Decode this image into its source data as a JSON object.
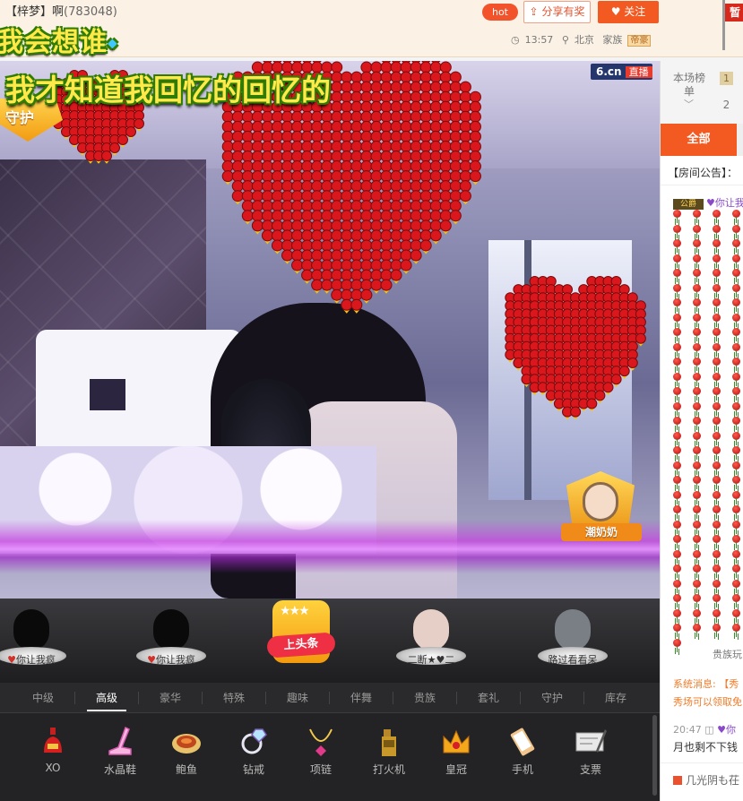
{
  "header": {
    "room_title": "【梓梦】啊",
    "room_id": "(783048)",
    "marquee_text": "我会想谁",
    "hot_label": "hot",
    "share_label": "分享有奖",
    "follow_label": "关注",
    "time": "13:57",
    "location": "北京",
    "family_label": "家族",
    "family_badge": "帝豪",
    "corner_flag": "暂"
  },
  "video": {
    "caption": "我才知道我回忆的回忆的",
    "guard_label": "守护",
    "logo": "6.cn",
    "live_label": "直播",
    "fan_badge_name": "潮奶奶"
  },
  "users_row": {
    "slots": [
      {
        "tag_prefix": "♥",
        "tag": "你让我疯"
      },
      {
        "tag_prefix": "♥",
        "tag": "你让我疯"
      },
      {
        "tag_prefix": "",
        "tag": "二断★♥二"
      },
      {
        "tag_prefix": "",
        "tag": "路过看看呆"
      }
    ],
    "headline_label": "上头条"
  },
  "gift_tabs": [
    "中级",
    "高级",
    "豪华",
    "特殊",
    "趣味",
    "伴舞",
    "贵族",
    "套礼",
    "守护",
    "库存"
  ],
  "gift_tab_active": "高级",
  "gifts": [
    {
      "icon": "xo-bottle-icon",
      "name": "XO"
    },
    {
      "icon": "crystal-shoe-icon",
      "name": "水晶鞋"
    },
    {
      "icon": "abalone-icon",
      "name": "鲍鱼"
    },
    {
      "icon": "ring-icon",
      "name": "钻戒"
    },
    {
      "icon": "necklace-icon",
      "name": "项链"
    },
    {
      "icon": "lighter-icon",
      "name": "打火机"
    },
    {
      "icon": "crown-icon",
      "name": "皇冠"
    },
    {
      "icon": "phone-icon",
      "name": "手机"
    },
    {
      "icon": "cheque-icon",
      "name": "支票"
    }
  ],
  "rank_panel": {
    "label": "本场榜单",
    "rank1": "1",
    "rank2": "2"
  },
  "chat": {
    "tab_all": "全部",
    "announcement": "【房间公告】：",
    "first_user_badge": "公爵",
    "first_msg": "♥你让我",
    "noble_text": "贵族玩",
    "sys_msg_1": "系统消息: 【秀",
    "sys_msg_2": "秀场可以领取免",
    "msg_time": "20:47",
    "msg_user": "♥你",
    "msg_text": "月也剩不下钱",
    "last_msg": "几光阴も茌"
  },
  "colors": {
    "accent": "#f25a22",
    "header_bg": "#fbf1e4",
    "caption_yellow": "#ffe84a",
    "caption_outline": "#2f7d00"
  }
}
